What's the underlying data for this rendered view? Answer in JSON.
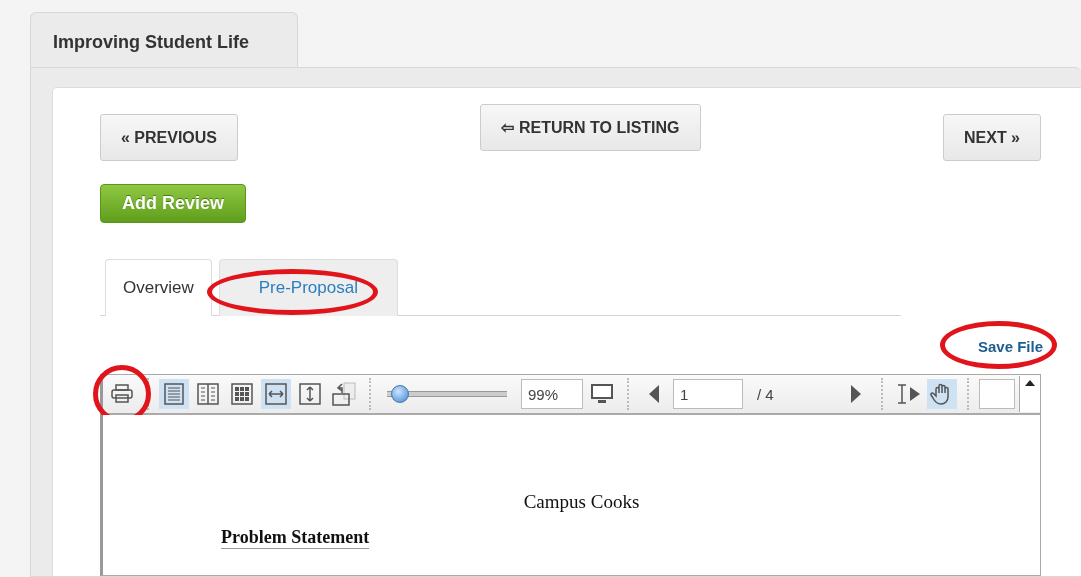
{
  "page_tab": {
    "title": "Improving Student Life"
  },
  "nav": {
    "previous": "« PREVIOUS",
    "return": "⇦ RETURN TO LISTING",
    "next": "NEXT »"
  },
  "add_review": "Add Review",
  "tabs": [
    {
      "label": "Overview",
      "selected": true,
      "highlighted": false
    },
    {
      "label": "Pre-Proposal",
      "selected": false,
      "highlighted": true
    }
  ],
  "save_file": {
    "label": "Save File",
    "highlighted": true
  },
  "viewer": {
    "tools": [
      {
        "kind": "print",
        "selected": false,
        "highlighted": true
      },
      {
        "kind": "single-page",
        "selected": true,
        "highlighted": false
      },
      {
        "kind": "two-page",
        "selected": false,
        "highlighted": false
      },
      {
        "kind": "grid",
        "selected": false,
        "highlighted": false
      },
      {
        "kind": "fit-width",
        "selected": true,
        "highlighted": false
      },
      {
        "kind": "fit-height",
        "selected": false,
        "highlighted": false
      },
      {
        "kind": "rotate",
        "selected": false,
        "highlighted": false
      }
    ],
    "zoom_slider": {
      "level": 0.1
    },
    "zoom_value": "99%",
    "page_value": "1",
    "page_total": "/ 4",
    "cursor_tools": [
      {
        "kind": "text-select",
        "selected": false
      },
      {
        "kind": "hand",
        "selected": true
      }
    ],
    "document": {
      "title": "Campus Cooks",
      "heading": "Problem Statement"
    }
  }
}
